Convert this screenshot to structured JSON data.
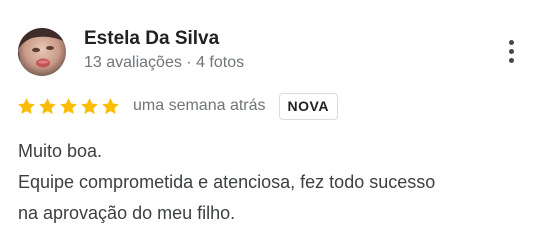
{
  "author": {
    "name": "Estela Da Silva",
    "meta": "13 avaliações · 4 fotos"
  },
  "icons": {
    "avatar": "user-photo",
    "more": "more-vertical-icon",
    "star": "star-icon"
  },
  "rating": {
    "stars": 5,
    "max": 5,
    "color": "#fbbc04"
  },
  "review": {
    "date": "uma semana atrás",
    "badge": "NOVA",
    "lines": [
      "Muito boa.",
      "Equipe comprometida e atenciosa, fez todo sucesso",
      "na aprovação do meu filho."
    ]
  }
}
